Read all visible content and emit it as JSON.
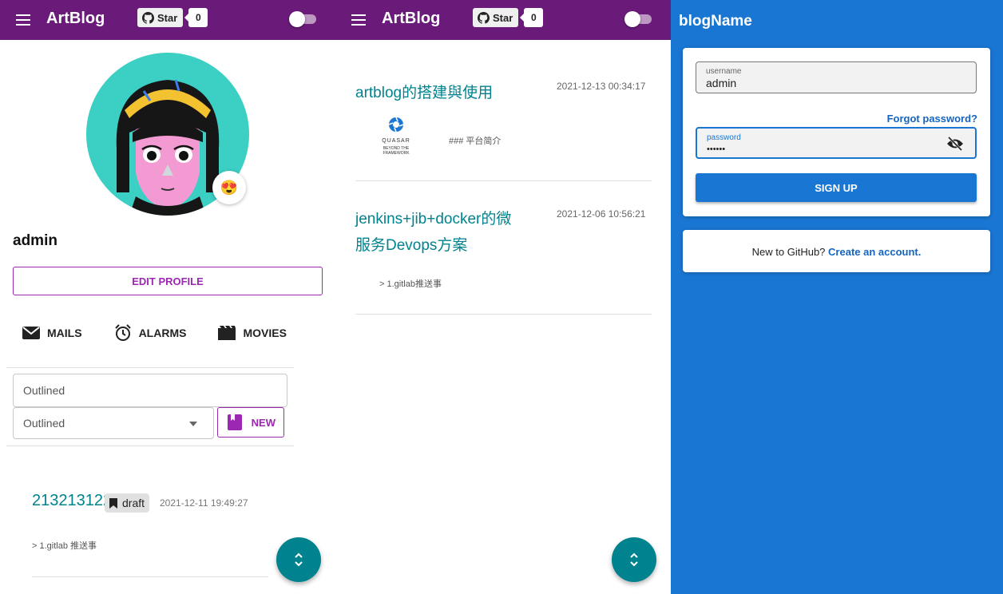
{
  "app": {
    "brand": "ArtBlog",
    "star_label": "Star",
    "star_count": "0"
  },
  "profile": {
    "name": "admin",
    "emoji": "😍",
    "edit_label": "EDIT PROFILE",
    "tabs": [
      {
        "label": "MAILS",
        "icon": "mail-icon"
      },
      {
        "label": "ALARMS",
        "icon": "alarm-icon"
      },
      {
        "label": "MOVIES",
        "icon": "movie-icon"
      }
    ],
    "search_placeholder": "Outlined",
    "select_value": "Outlined",
    "new_label": "NEW"
  },
  "my_posts": [
    {
      "title": "213213122132213是",
      "tag": "draft",
      "date": "2021-12-11 19:49:27",
      "excerpt": "> 1.gitlab 推送事"
    }
  ],
  "feed": [
    {
      "title": "artblog的搭建與使用",
      "date": "2021-12-13 00:34:17",
      "excerpt": "### 平台简介",
      "logo": {
        "name": "QUASAR",
        "tagline": "BEYOND THE FRAMEWORK"
      }
    },
    {
      "title_line1": "jenkins+jib+docker的微",
      "title_line2": "服务Devops方案",
      "date": "2021-12-06 10:56:21",
      "excerpt": "> 1.gitlab推送事"
    }
  ],
  "login": {
    "blog_name": "blogName",
    "username_label": "username",
    "username_value": "admin",
    "forgot_label": "Forgot password?",
    "password_label": "password",
    "password_value": "••••••",
    "signup_label": "SIGN UP",
    "new_text": "New to GitHub?",
    "create_label": "Create an account."
  },
  "colors": {
    "header": "#6a1b7a",
    "accent": "#9c27b0",
    "teal": "#00838f",
    "login_bg": "#1976d2"
  }
}
